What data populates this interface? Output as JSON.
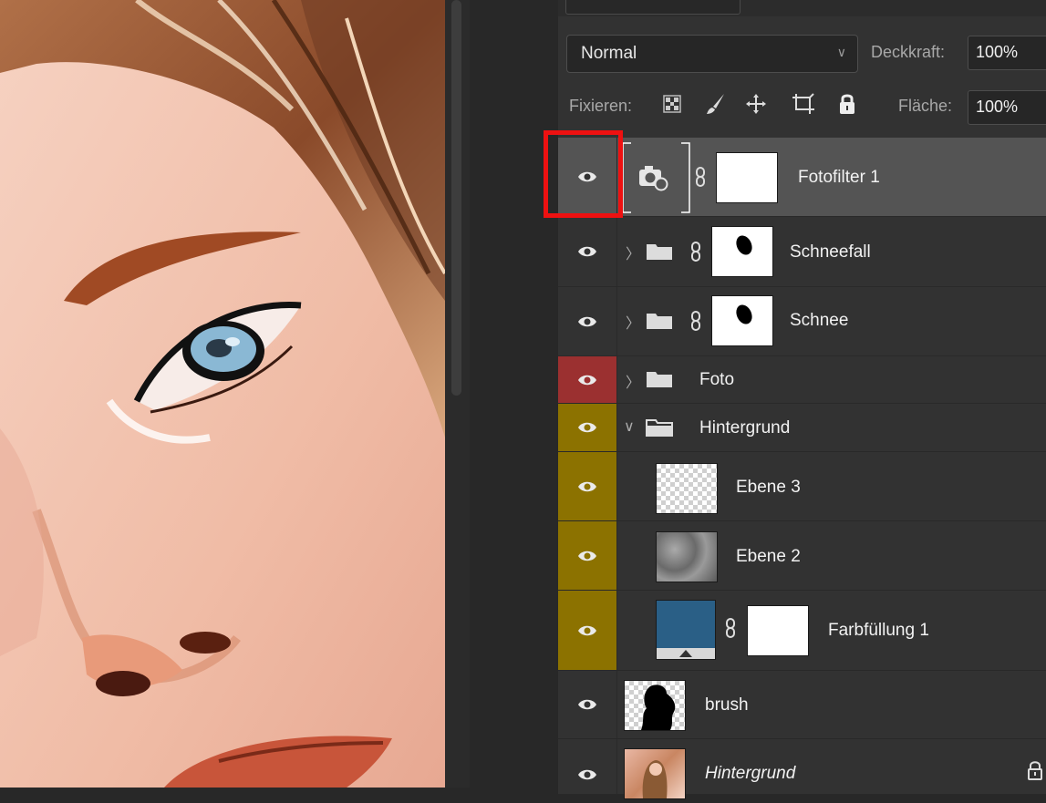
{
  "blend_mode": {
    "value": "Normal"
  },
  "opacity": {
    "label": "Deckkraft:",
    "value": "100%"
  },
  "lock": {
    "label": "Fixieren:",
    "icons": [
      "lock-transparent-pixels-icon",
      "lock-image-pixels-icon",
      "lock-position-icon",
      "lock-artboard-icon",
      "lock-all-icon"
    ]
  },
  "fill": {
    "label": "Fläche:",
    "value": "100%"
  },
  "layers": [
    {
      "name": "Fotofilter 1",
      "type": "adjustment",
      "selected": true,
      "eye_color": ""
    },
    {
      "name": "Schneefall",
      "type": "group-with-mask",
      "expanded": false,
      "eye_color": ""
    },
    {
      "name": "Schnee",
      "type": "group-with-mask",
      "expanded": false,
      "eye_color": ""
    },
    {
      "name": "Foto",
      "type": "group",
      "expanded": false,
      "eye_color": "#9b3030"
    },
    {
      "name": "Hintergrund",
      "type": "group",
      "expanded": true,
      "eye_color": "#8c7200"
    },
    {
      "name": "Ebene 3",
      "type": "pixel",
      "eye_color": "#8c7200"
    },
    {
      "name": "Ebene 2",
      "type": "pixel",
      "eye_color": "#8c7200"
    },
    {
      "name": "Farbfüllung 1",
      "type": "fill",
      "fill_color": "#2a5f86",
      "eye_color": "#8c7200"
    },
    {
      "name": "brush",
      "type": "pixel",
      "eye_color": ""
    },
    {
      "name": "Hintergrund",
      "type": "background",
      "locked": true,
      "eye_color": ""
    }
  ],
  "highlight_color": "#ee1111"
}
